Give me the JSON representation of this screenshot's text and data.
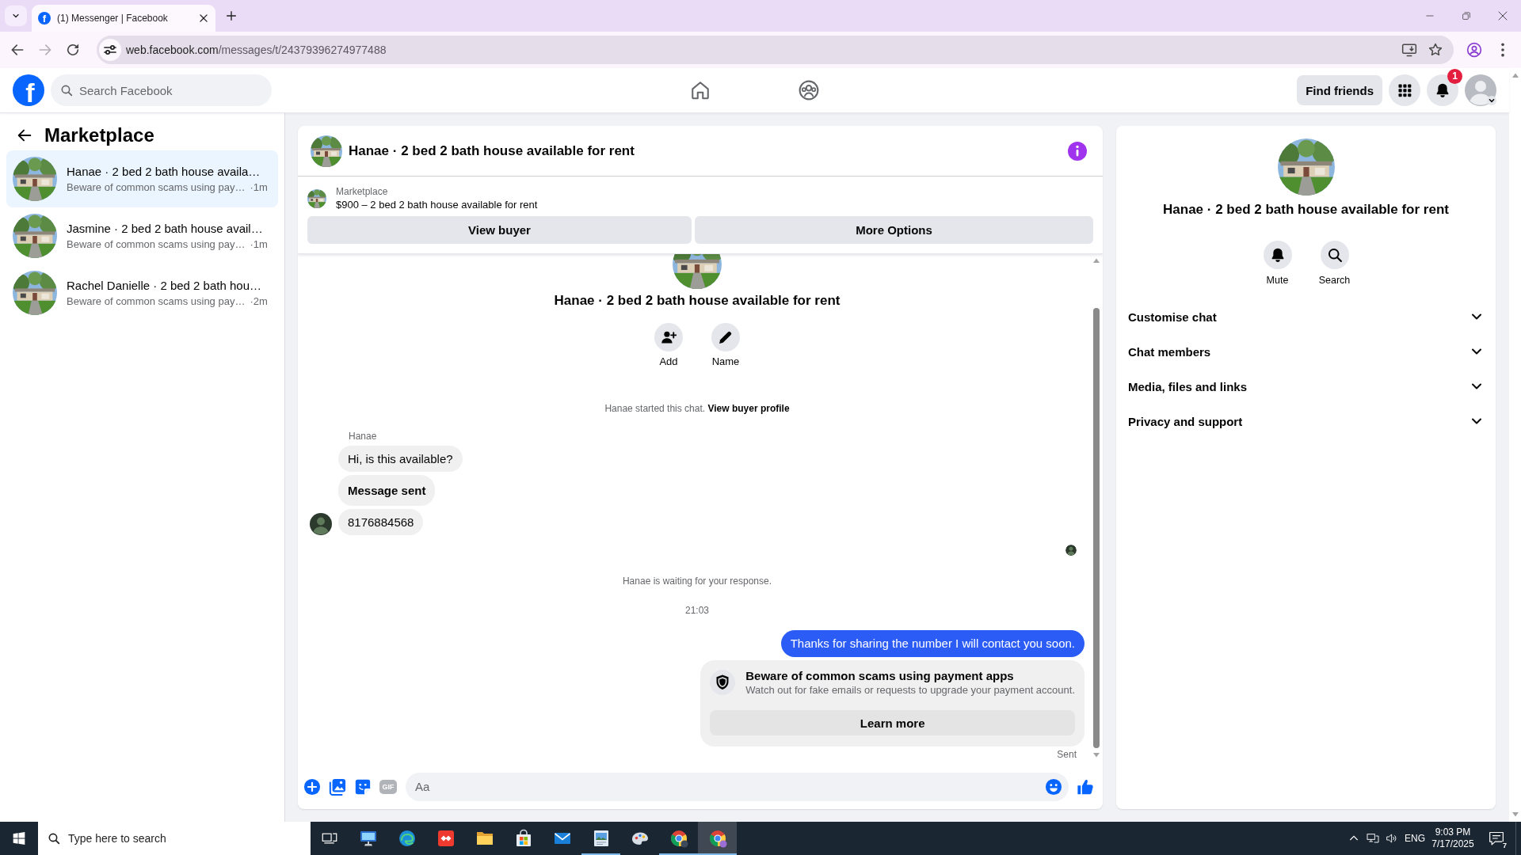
{
  "browser": {
    "tabs": [
      {
        "favicon": "f",
        "title": "(1) Messenger | Facebook",
        "selected": true
      }
    ],
    "nav_buttons": [
      {
        "kind": "back",
        "disabled": false
      },
      {
        "kind": "forward",
        "disabled": true
      },
      {
        "kind": "reload",
        "disabled": false
      }
    ],
    "url": {
      "host": "web.facebook.com",
      "path": "/messages/t/24379396274977488"
    }
  },
  "header": {
    "logo": "f",
    "search": {
      "placeholder": "Search Facebook"
    },
    "find_friends": "Find friends",
    "notification_count": "1"
  },
  "sidebar": {
    "title": "Marketplace",
    "conversations": [
      {
        "title": "Hanae · 2 bed 2 bath house availa…",
        "preview": "Beware of common scams using pay…",
        "time": "·1m",
        "selected": true
      },
      {
        "title": "Jasmine · 2 bed 2 bath house avail…",
        "preview": "Beware of common scams using pay…",
        "time": "·1m",
        "selected": false
      },
      {
        "title": "Rachel Danielle · 2 bed 2 bath hou…",
        "preview": "Beware of common scams using pay…",
        "time": "·2m",
        "selected": false
      }
    ]
  },
  "chat": {
    "title": "Hanae · 2 bed 2 bath house available for rent",
    "listing": {
      "source": "Marketplace",
      "summary": "$900 – 2 bed 2 bath house available for rent"
    },
    "buttons": [
      "View buyer",
      "More Options"
    ],
    "intro": {
      "title": "Hanae · 2 bed 2 bath house available for rent",
      "actions": [
        {
          "kind": "add",
          "label": "Add"
        },
        {
          "kind": "rename",
          "label": "Name"
        }
      ]
    },
    "start_note": {
      "text": "Hanae started this chat.",
      "link": "View buyer profile"
    },
    "sender": "Hanae",
    "incoming": [
      {
        "text": "Hi, is this available?",
        "bold": false
      },
      {
        "text": "Message sent",
        "bold": true
      },
      {
        "text": "8176884568",
        "bold": false
      }
    ],
    "status_note": "Hanae is waiting for your response.",
    "timestamp": "21:03",
    "outgoing": [
      {
        "text": "Thanks for sharing the number I will contact you soon."
      }
    ],
    "notice": {
      "title": "Beware of common scams using payment apps",
      "body": "Watch out for fake emails or requests to upgrade your payment account.",
      "button": "Learn more"
    },
    "delivery_status": "Sent",
    "composer": {
      "gif": "GIF",
      "placeholder": "Aa"
    }
  },
  "details": {
    "title": "Hanae · 2 bed 2 bath house available for rent",
    "actions": [
      {
        "kind": "mute",
        "label": "Mute"
      },
      {
        "kind": "search",
        "label": "Search"
      }
    ],
    "sections": [
      {
        "label": "Customise chat",
        "expanded": false
      },
      {
        "label": "Chat members",
        "expanded": false
      },
      {
        "label": "Media, files and links",
        "expanded": false
      },
      {
        "label": "Privacy and support",
        "expanded": false
      }
    ]
  },
  "taskbar": {
    "search": {
      "placeholder": "Type here to search"
    },
    "apps": [
      {
        "running": false,
        "selected": false
      },
      {
        "running": false,
        "selected": false
      },
      {
        "running": false,
        "selected": false
      },
      {
        "running": false,
        "selected": false
      },
      {
        "running": false,
        "selected": false
      },
      {
        "running": false,
        "selected": false
      },
      {
        "running": true,
        "selected": false
      },
      {
        "running": false,
        "selected": false
      },
      {
        "running": true,
        "selected": false
      },
      {
        "running": true,
        "selected": true
      }
    ],
    "language": "ENG",
    "time": "9:03 PM",
    "date": "7/17/2025",
    "notifications": "7"
  }
}
